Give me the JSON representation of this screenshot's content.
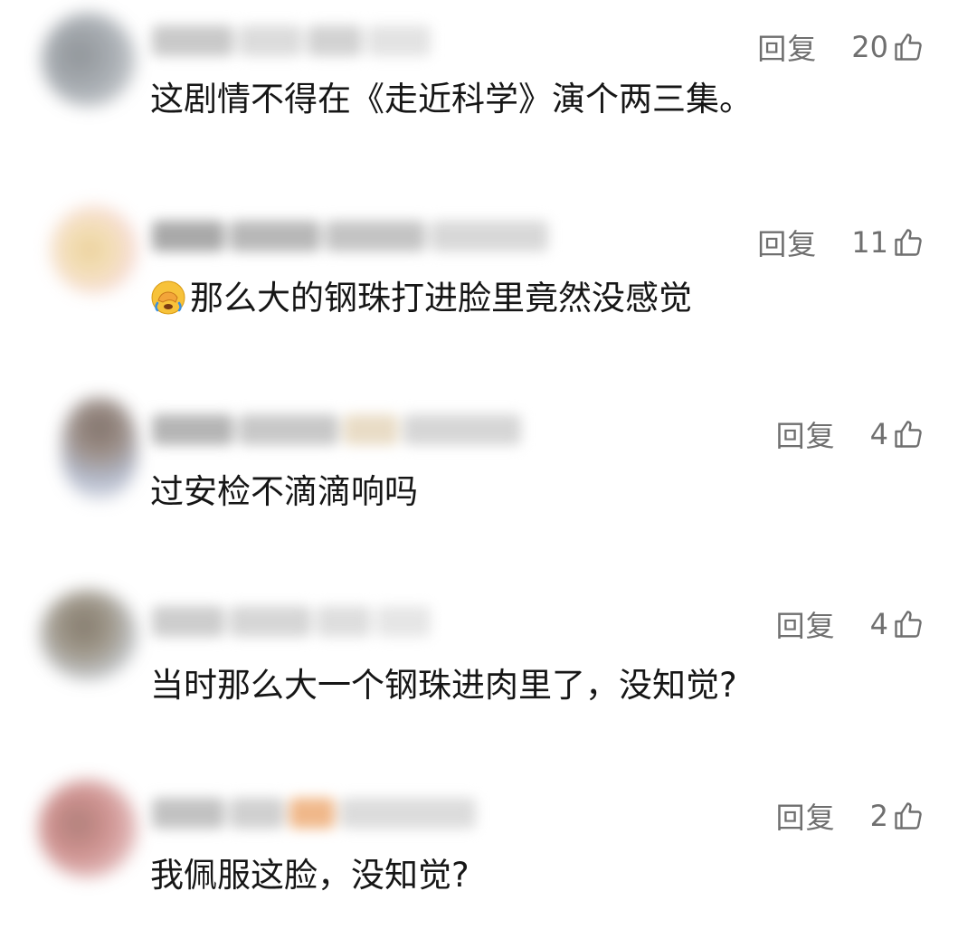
{
  "comments": [
    {
      "reply_label": "回复",
      "likes": "20",
      "text": "这剧情不得在《走近科学》演个两三集。",
      "emoji": "",
      "avatar_colors": [
        "#7d8287",
        "#b7bbc0"
      ],
      "name_colors": [
        "#c9c9c9",
        "#dcdcdc",
        "#d2d2d2",
        "#e3e3e3"
      ]
    },
    {
      "reply_label": "回复",
      "likes": "11",
      "text": "那么大的钢珠打进脸里竟然没感觉",
      "emoji": "face-with-hand-over-eyes-crying-icon",
      "avatar_colors": [
        "#e6d6a6",
        "#f1c8c8"
      ],
      "name_colors": [
        "#a9a9a9",
        "#b8b8b8",
        "#c4c4c4",
        "#d8d8d8"
      ]
    },
    {
      "reply_label": "回复",
      "likes": "4",
      "text": "过安检不滴滴响吗",
      "emoji": "",
      "avatar_colors": [
        "#6b5a52",
        "#a8b0c4"
      ],
      "name_colors": [
        "#b5b5b5",
        "#c8c8c8",
        "#e9dcc6",
        "#d6d6d6"
      ]
    },
    {
      "reply_label": "回复",
      "likes": "4",
      "text": "当时那么大一个钢珠进肉里了，没知觉?",
      "emoji": "",
      "avatar_colors": [
        "#6f6454",
        "#9ea3a8"
      ],
      "name_colors": [
        "#cdcdcd",
        "#d6d6d6",
        "#dedede",
        "#e6e6e6"
      ]
    },
    {
      "reply_label": "回复",
      "likes": "2",
      "text": "我佩服这脸，没知觉?",
      "emoji": "",
      "avatar_colors": [
        "#a06a64",
        "#d28a8a"
      ],
      "name_colors": [
        "#c2c2c2",
        "#d0d0d0",
        "#f0b88a",
        "#dcdcdc"
      ]
    }
  ]
}
